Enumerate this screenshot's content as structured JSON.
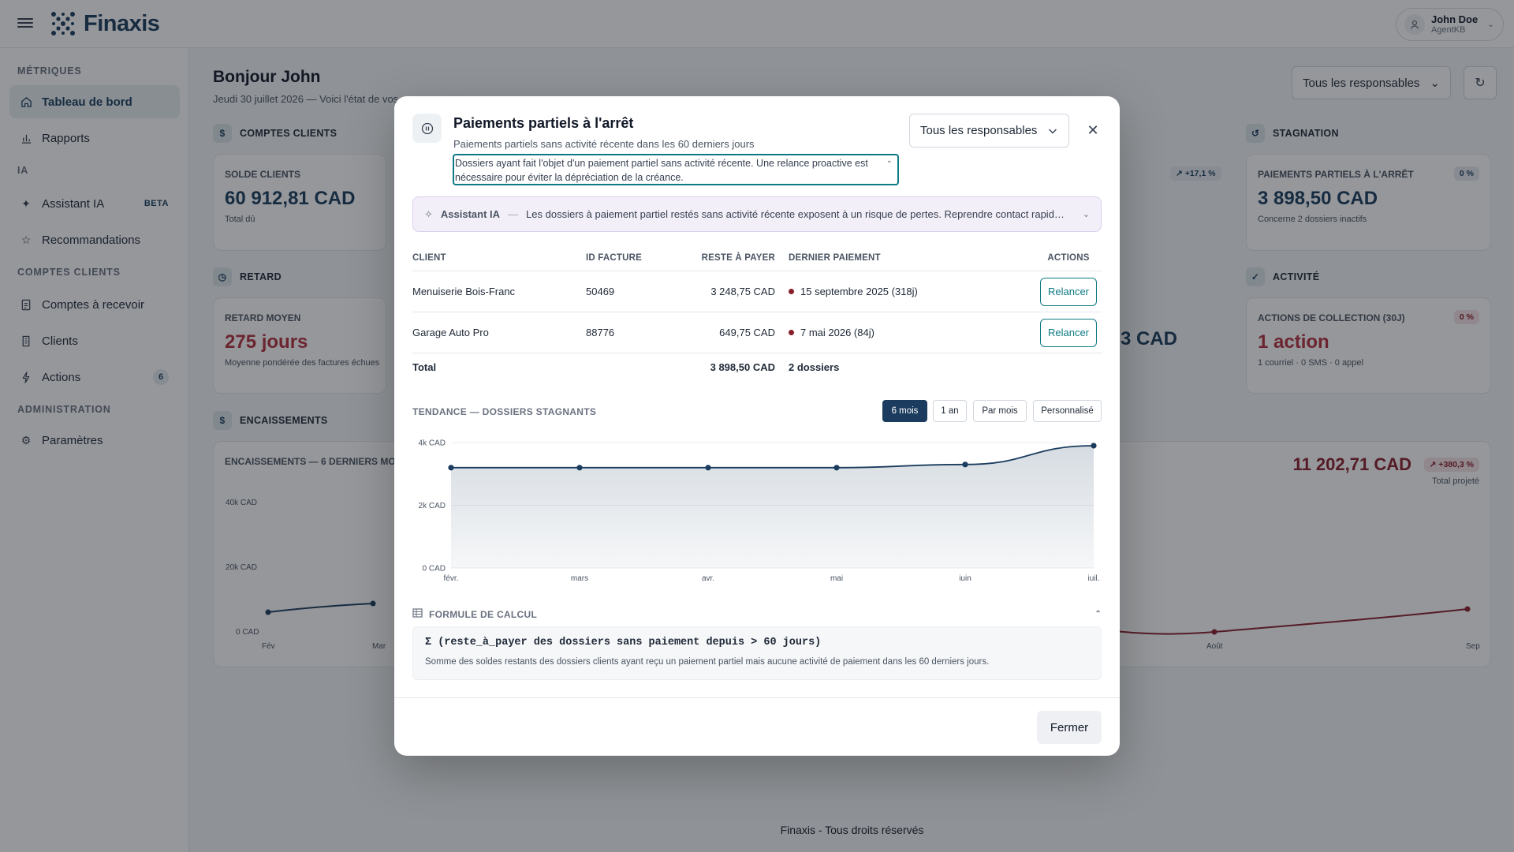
{
  "app": {
    "name": "Finaxis"
  },
  "user": {
    "name": "John Doe",
    "role": "AgentKB"
  },
  "sidebar": {
    "sections": [
      {
        "title": "MÉTRIQUES",
        "items": [
          {
            "label": "Tableau de bord",
            "icon": "home-icon",
            "active": true
          },
          {
            "label": "Rapports",
            "icon": "bar-chart-icon"
          }
        ]
      },
      {
        "title": "IA",
        "items": [
          {
            "label": "Assistant IA",
            "icon": "sparkle-icon",
            "badge": "BETA"
          },
          {
            "label": "Recommandations",
            "icon": "star-icon"
          }
        ]
      },
      {
        "title": "COMPTES CLIENTS",
        "items": [
          {
            "label": "Comptes à recevoir",
            "icon": "document-icon"
          },
          {
            "label": "Clients",
            "icon": "building-icon"
          },
          {
            "label": "Actions",
            "icon": "bolt-icon",
            "count": "6"
          }
        ]
      },
      {
        "title": "ADMINISTRATION",
        "items": [
          {
            "label": "Paramètres",
            "icon": "gear-icon"
          }
        ]
      }
    ]
  },
  "dashboard": {
    "greeting": "Bonjour John",
    "subtitle": "Jeudi 30 juillet 2026 — Voici l'état de vos",
    "responsable_filter": "Tous les responsables",
    "sections": {
      "comptes_clients": "COMPTES CLIENTS",
      "retard": "RETARD",
      "encaissements": "ENCAISSEMENTS",
      "stagnation": "STAGNATION",
      "activite": "ACTIVITÉ"
    },
    "cards": {
      "solde": {
        "label": "SOLDE CLIENTS",
        "value": "60 912,81 CAD",
        "sub": "Total dû"
      },
      "retard": {
        "label": "RETARD MOYEN",
        "value": "275 jours",
        "sub": "Moyenne pondérée des factures échues"
      },
      "partiels": {
        "label": "PAIEMENTS PARTIELS À L'ARRÊT",
        "value": "3 898,50 CAD",
        "sub": "Concerne 2 dossiers inactifs",
        "pill": "0 %"
      },
      "actions": {
        "label": "ACTIONS DE COLLECTION (30J)",
        "value": "1 action",
        "sub": "1 courriel · 0 SMS · 0 appel",
        "pill": "0 %"
      },
      "mid_pill": "↗ +17,1 %",
      "mid_value": "3 CAD",
      "encaissements": {
        "label": "ENCAISSEMENTS — 6 DERNIERS MOIS",
        "y_ticks": [
          "40k CAD",
          "20k CAD",
          "0 CAD"
        ],
        "x_ticks": [
          "Fév",
          "Mar",
          "Août",
          "Sep"
        ],
        "projected": "11 202,71 CAD",
        "projected_pill": "↗ +380,3 %",
        "projected_sub": "Total projeté"
      }
    },
    "footer": "Finaxis - Tous droits réservés"
  },
  "modal": {
    "title": "Paiements partiels à l'arrêt",
    "subtitle": "Paiements partiels sans activité récente dans les 60 derniers jours",
    "description": "Dossiers ayant fait l'objet d'un paiement partiel sans activité récente. Une relance proactive est nécessaire pour éviter la dépréciation de la créance.",
    "filter": "Tous les responsables",
    "ai": {
      "label": "Assistant IA",
      "sep": "—",
      "text": "Les dossiers à paiement partiel restés sans activité récente exposent à un risque de pertes. Reprendre contact rapidem..."
    },
    "table": {
      "headers": [
        "CLIENT",
        "ID FACTURE",
        "RESTE À PAYER",
        "DERNIER PAIEMENT",
        "ACTIONS"
      ],
      "rows": [
        {
          "client": "Menuiserie Bois-Franc",
          "id": "50469",
          "reste": "3 248,75 CAD",
          "dernier": "15 septembre 2025 (318j)",
          "action": "Relancer"
        },
        {
          "client": "Garage Auto Pro",
          "id": "88776",
          "reste": "649,75 CAD",
          "dernier": "7 mai 2026 (84j)",
          "action": "Relancer"
        }
      ],
      "total": {
        "label": "Total",
        "reste": "3 898,50 CAD",
        "dossiers": "2 dossiers"
      }
    },
    "trend_title": "TENDANCE — DOSSIERS STAGNANTS",
    "ranges": [
      {
        "label": "6 mois",
        "active": true
      },
      {
        "label": "1 an"
      },
      {
        "label": "Par mois"
      },
      {
        "label": "Personnalisé"
      }
    ],
    "formula_title": "FORMULE DE CALCUL",
    "formula_code": "Σ (reste_à_payer des dossiers sans paiement depuis > 60 jours)",
    "formula_text": "Somme des soldes restants des dossiers clients ayant reçu un paiement partiel mais aucune activité de paiement dans les 60 derniers jours.",
    "close_label": "Fermer"
  },
  "chart_data": {
    "type": "area",
    "x": [
      "févr.",
      "mars",
      "avr.",
      "mai",
      "juin",
      "juil."
    ],
    "y_ticks": [
      "4k CAD",
      "2k CAD",
      "0 CAD"
    ],
    "ylim": [
      0,
      4000
    ],
    "series": [
      {
        "values": [
          3200,
          3200,
          3200,
          3200,
          3300,
          3900
        ]
      }
    ],
    "color": "#1b3c5e"
  }
}
